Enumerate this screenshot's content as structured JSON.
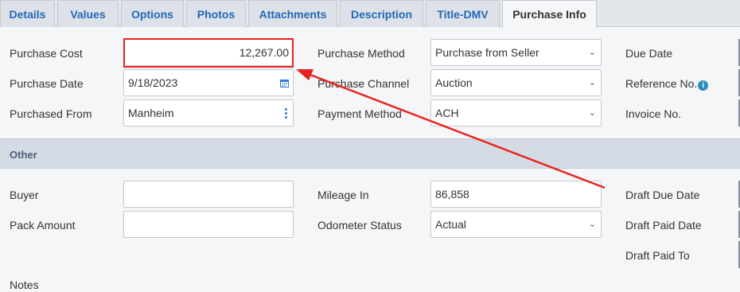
{
  "tabs": [
    {
      "label": "Details",
      "active": false
    },
    {
      "label": "Values",
      "active": false
    },
    {
      "label": "Options",
      "active": false
    },
    {
      "label": "Photos",
      "active": false
    },
    {
      "label": "Attachments",
      "active": false
    },
    {
      "label": "Description",
      "active": false
    },
    {
      "label": "Title-DMV",
      "active": false
    },
    {
      "label": "Purchase Info",
      "active": true
    }
  ],
  "purchase": {
    "cost_label": "Purchase Cost",
    "cost_value": "12,267.00",
    "date_label": "Purchase Date",
    "date_value": "9/18/2023",
    "from_label": "Purchased From",
    "from_value": "Manheim",
    "method_label": "Purchase Method",
    "method_value": "Purchase from Seller",
    "channel_label": "Purchase Channel",
    "channel_value": "Auction",
    "payment_label": "Payment Method",
    "payment_value": "ACH",
    "due_date_label": "Due Date",
    "reference_label": "Reference No.",
    "invoice_label": "Invoice No."
  },
  "other": {
    "section_title": "Other",
    "buyer_label": "Buyer",
    "buyer_value": "",
    "pack_label": "Pack Amount",
    "pack_value": "",
    "mileage_label": "Mileage In",
    "mileage_value": "86,858",
    "odometer_label": "Odometer Status",
    "odometer_value": "Actual",
    "draft_due_label": "Draft Due Date",
    "draft_paid_date_label": "Draft Paid Date",
    "draft_paid_to_label": "Draft Paid To",
    "notes_label": "Notes"
  },
  "icons": {
    "calendar": "calendar-icon",
    "kebab": "more-vertical-icon",
    "chevron": "chevron-down-icon",
    "info": "info-icon",
    "info_glyph": "i"
  },
  "colors": {
    "tab_text": "#2367b8",
    "highlight": "#e8231f",
    "section_bg": "#d5dbe4"
  }
}
